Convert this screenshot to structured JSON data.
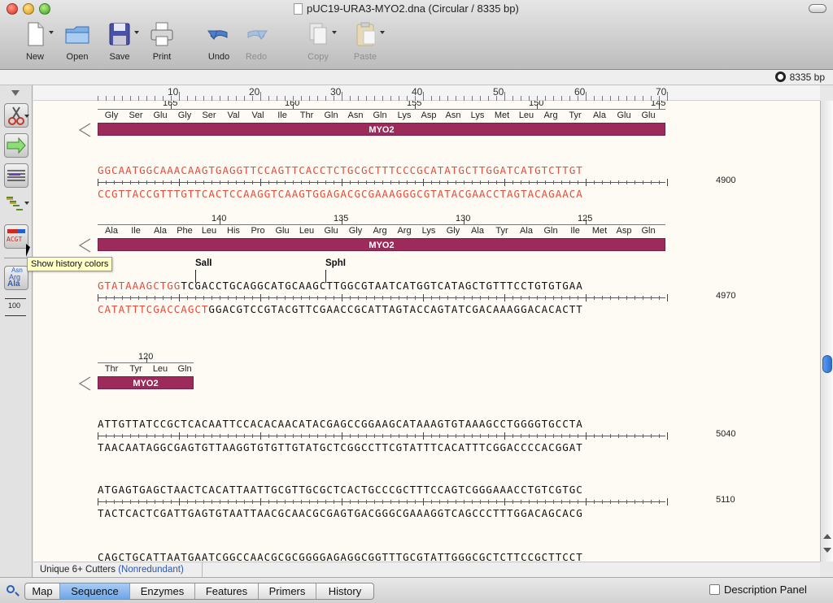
{
  "window": {
    "title": "pUC19-URA3-MYO2.dna  (Circular / 8335 bp)"
  },
  "toolbar": {
    "new_label": "New",
    "open_label": "Open",
    "save_label": "Save",
    "print_label": "Print",
    "undo_label": "Undo",
    "redo_label": "Redo",
    "copy_label": "Copy",
    "paste_label": "Paste"
  },
  "status": {
    "length": "8335 bp"
  },
  "ruler": {
    "ticks": [
      "10",
      "20",
      "30",
      "40",
      "50",
      "60",
      "70"
    ]
  },
  "tooltip": "Show history colors",
  "left_tools": {
    "ruler_value": "100",
    "aa_labels": [
      "Asn",
      "Arg",
      "Ala"
    ],
    "color_label": "ACGT"
  },
  "blocks": [
    {
      "aa_numbers": [
        {
          "n": "165",
          "idx": 2
        },
        {
          "n": "160",
          "idx": 7
        },
        {
          "n": "155",
          "idx": 12
        },
        {
          "n": "150",
          "idx": 17
        },
        {
          "n": "145",
          "idx": 22
        }
      ],
      "aa": [
        "Gly",
        "Ser",
        "Glu",
        "Gly",
        "Ser",
        "Val",
        "Val",
        "Ile",
        "Thr",
        "Gln",
        "Asn",
        "Gln",
        "Lys",
        "Asp",
        "Asn",
        "Lys",
        "Met",
        "Leu",
        "Arg",
        "Tyr",
        "Ala",
        "Glu",
        "Glu"
      ],
      "feature": "MYO2",
      "top": "GGCAATGGCAAACAAGTGAGGTTCCAGTTCACCTCTGCGCTTTCCCGCATATGCTTGGATCATGTCTTGT",
      "bottom": "CCGTTACCGTTTGTTCACTCCAAGGTCAAGTGGAGACGCGAAAGGGCGTATACGAACCTAGTACAGAACA",
      "coord": "4900",
      "top_red": 70,
      "bottom_red": 70
    },
    {
      "aa_numbers": [
        {
          "n": "140",
          "idx": 4
        },
        {
          "n": "135",
          "idx": 9
        },
        {
          "n": "130",
          "idx": 14
        },
        {
          "n": "125",
          "idx": 19
        }
      ],
      "aa": [
        "Ala",
        "Ile",
        "Ala",
        "Phe",
        "Leu",
        "His",
        "Pro",
        "Glu",
        "Leu",
        "Glu",
        "Gly",
        "Arg",
        "Arg",
        "Lys",
        "Gly",
        "Ala",
        "Tyr",
        "Ala",
        "Gln",
        "Ile",
        "Met",
        "Asp",
        "Gln"
      ],
      "feature": "MYO2",
      "enzymes": [
        {
          "name": "SalI",
          "pos": 12
        },
        {
          "name": "SphI",
          "pos": 28
        }
      ],
      "top": "GTATAAAGCTGGTCGACCTGCAGGCATGCAAGCTTGGCGTAATCATGGTCATAGCTGTTTCCTGTGTGAA",
      "bottom": "CATATTTCGACCAGCTGGACGTCCGTACGTTCGAACCGCATTAGTACCAGTATCGACAAAGGACACACTT",
      "coord": "4970",
      "top_red": 12,
      "bottom_red": 16
    },
    {
      "aa_numbers": [
        {
          "n": "120",
          "idx": 1
        }
      ],
      "aa": [
        "Thr",
        "Tyr",
        "Leu",
        "Gln"
      ],
      "feature": "MYO2",
      "top": "ATTGTTATCCGCTCACAATTCCACACAACATACGAGCCGGAAGCATAAAGTGTAAAGCCTGGGGTGCCTA",
      "bottom": "TAACAATAGGCGAGTGTTAAGGTGTGTTGTATGCTCGGCCTTCGTATTTCACATTTCGGACCCCACGGAT",
      "coord": "5040"
    },
    {
      "top": "ATGAGTGAGCTAACTCACATTAATTGCGTTGCGCTCACTGCCCGCTTTCCAGTCGGGAAACCTGTCGTGC",
      "bottom": "TACTCACTCGATTGAGTGTAATTAACGCAACGCGAGTGACGGGCGAAAGGTCAGCCCTTTGGACAGCACG",
      "coord": "5110"
    },
    {
      "top": "CAGCTGCATTAATGAATCGGCCAACGCGCGGGGAGAGGCGGTTTGCGTATTGGGCGCTCTTCCGCTTCCT"
    }
  ],
  "bottom_info": {
    "cutters": "Unique 6+ Cutters",
    "mode": "(Nonredundant)"
  },
  "tabs": [
    "Map",
    "Sequence",
    "Enzymes",
    "Features",
    "Primers",
    "History"
  ],
  "active_tab": "Sequence",
  "description_panel": "Description Panel"
}
